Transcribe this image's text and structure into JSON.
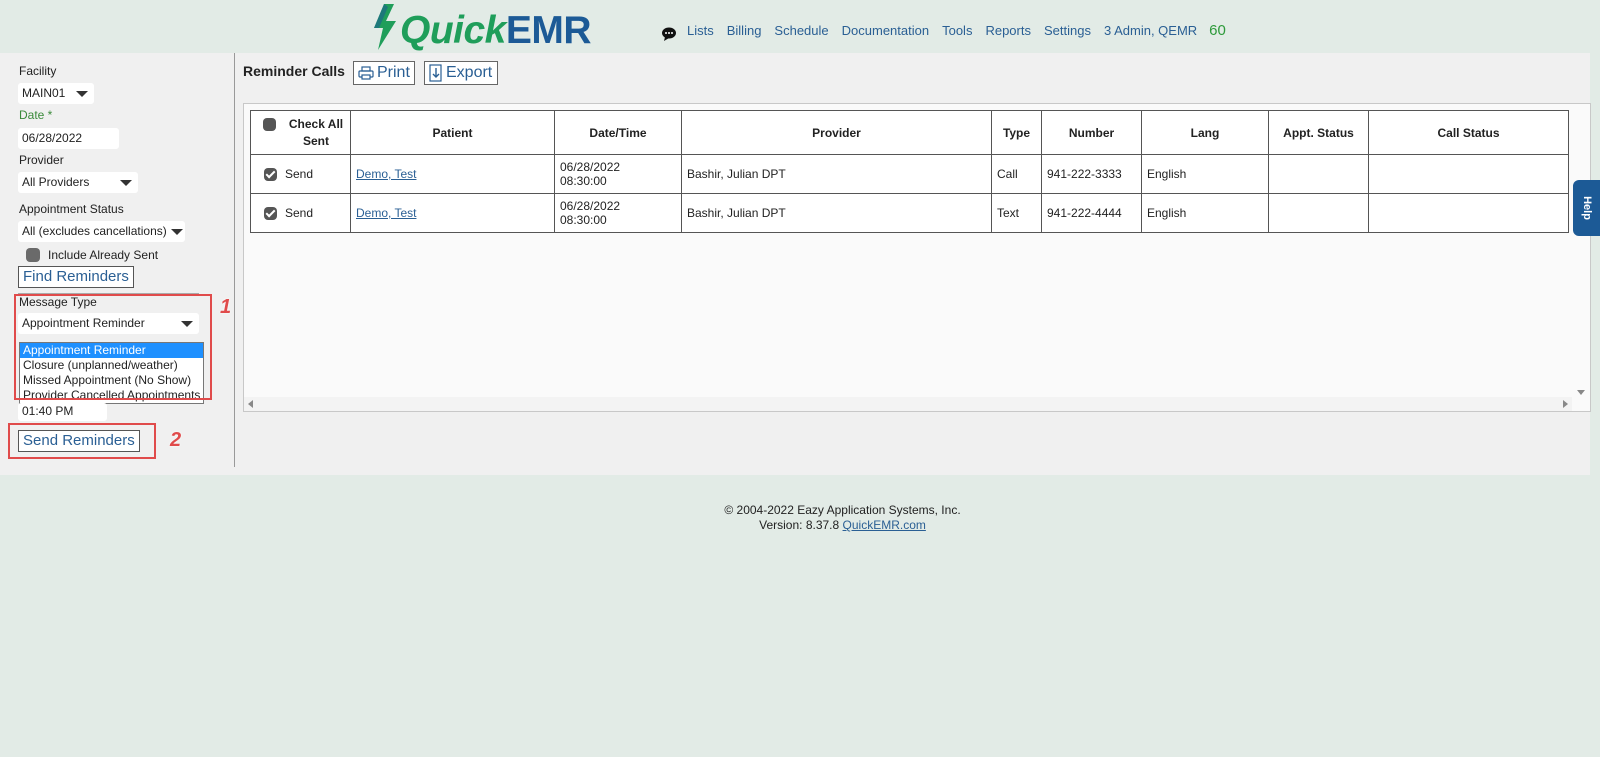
{
  "header": {
    "logo_quick": "Quick",
    "logo_emr": "EMR",
    "nav": [
      "Lists",
      "Billing",
      "Schedule",
      "Documentation",
      "Tools",
      "Reports",
      "Settings",
      "3 Admin, QEMR"
    ],
    "counter": "60"
  },
  "sidebar": {
    "facility_label": "Facility",
    "facility_value": "MAIN01",
    "date_label": "Date *",
    "date_value": "06/28/2022",
    "provider_label": "Provider",
    "provider_value": "All Providers",
    "appt_status_label": "Appointment Status",
    "appt_status_value": "All (excludes cancellations)",
    "include_sent_label": "Include Already Sent",
    "find_button": "Find Reminders",
    "message_type_label": "Message Type",
    "message_type_value": "Appointment Reminder",
    "message_type_options": [
      "Appointment Reminder",
      "Closure (unplanned/weather)",
      "Missed Appointment (No Show)",
      "Provider Cancelled Appointments"
    ],
    "time_value": "01:40 PM",
    "send_button": "Send Reminders",
    "annotation_1": "1",
    "annotation_2": "2"
  },
  "content": {
    "title": "Reminder Calls",
    "print_label": "Print",
    "export_label": "Export",
    "columns": {
      "check_all": "Check All Sent",
      "patient": "Patient",
      "datetime": "Date/Time",
      "provider": "Provider",
      "type": "Type",
      "number": "Number",
      "lang": "Lang",
      "appt_status": "Appt. Status",
      "call_status": "Call Status"
    },
    "rows": [
      {
        "send": "Send",
        "patient": "Demo, Test",
        "date": "06/28/2022",
        "time": "08:30:00",
        "provider": "Bashir, Julian DPT",
        "type": "Call",
        "number": "941-222-3333",
        "lang": "English",
        "appt_status": "",
        "call_status": ""
      },
      {
        "send": "Send",
        "patient": "Demo, Test",
        "date": "06/28/2022",
        "time": "08:30:00",
        "provider": "Bashir, Julian DPT",
        "type": "Text",
        "number": "941-222-4444",
        "lang": "English",
        "appt_status": "",
        "call_status": ""
      }
    ],
    "help_label": "Help"
  },
  "footer": {
    "copyright": "© 2004-2022 Eazy Application Systems, Inc.",
    "version": "Version: 8.37.8",
    "link": "QuickEMR.com"
  }
}
